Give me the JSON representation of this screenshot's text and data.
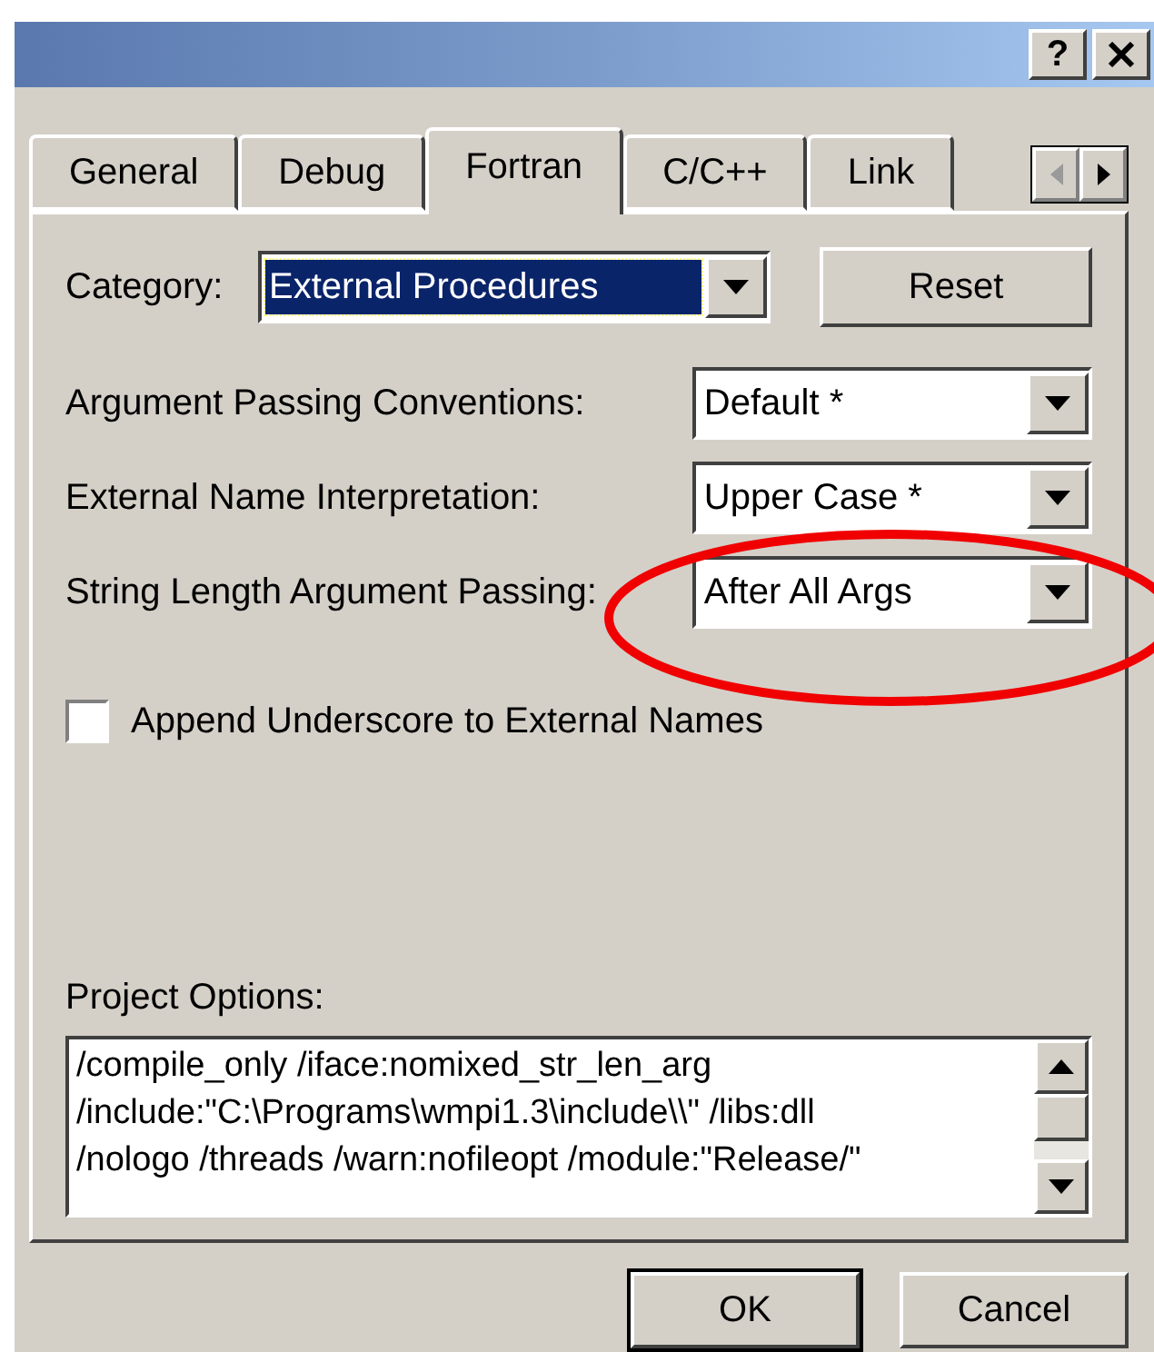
{
  "title_bar": {
    "help_button": "?"
  },
  "tabs": [
    {
      "label": "General",
      "selected": false
    },
    {
      "label": "Debug",
      "selected": false
    },
    {
      "label": "Fortran",
      "selected": true
    },
    {
      "label": "C/C++",
      "selected": false
    },
    {
      "label": "Link",
      "selected": false
    }
  ],
  "category": {
    "label": "Category:",
    "value": "External Procedures",
    "focused": true
  },
  "reset_button": "Reset",
  "fields": [
    {
      "label": "Argument Passing Conventions:",
      "value": "Default *"
    },
    {
      "label": "External Name Interpretation:",
      "value": "Upper Case *"
    },
    {
      "label": "String Length Argument Passing:",
      "value": "After All Args"
    }
  ],
  "checkbox": {
    "label": "Append Underscore to External Names",
    "checked": false
  },
  "project_options": {
    "label": "Project Options:",
    "value": "/compile_only /iface:nomixed_str_len_arg\n/include:\"C:\\Programs\\wmpi1.3\\include\\\\\" /libs:dll\n/nologo /threads /warn:nofileopt /module:\"Release/\""
  },
  "buttons": [
    {
      "label": "OK",
      "default": true
    },
    {
      "label": "Cancel",
      "default": false
    }
  ]
}
